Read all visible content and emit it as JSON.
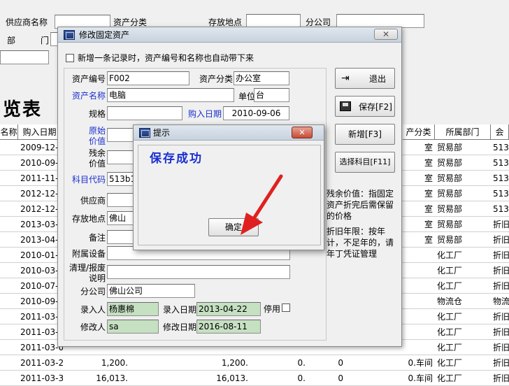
{
  "top_form": {
    "supplier_label": "供应商名称",
    "category_label": "资产分类",
    "location_label": "存放地点",
    "branch_label": "分公司",
    "dept_label": "部",
    "dept_label2": "门"
  },
  "list_title": "览表",
  "list_headers": [
    "名称",
    "购入日期",
    "产分类",
    "所属部门",
    "会"
  ],
  "list_rows": [
    {
      "date": "2009-12-3",
      "cat": "室",
      "dept": "贸易部",
      "acct": "513"
    },
    {
      "date": "2010-09-0",
      "cat": "室",
      "dept": "贸易部",
      "acct": "513"
    },
    {
      "date": "2011-11-3",
      "cat": "室",
      "dept": "贸易部",
      "acct": "513"
    },
    {
      "date": "2012-12-3",
      "cat": "室",
      "dept": "贸易部",
      "acct": "513"
    },
    {
      "date": "2012-12-3",
      "cat": "室",
      "dept": "贸易部",
      "acct": "513"
    },
    {
      "date": "2013-03-",
      "cat": "室",
      "dept": "贸易部",
      "acct": "折旧"
    },
    {
      "date": "2013-04-2",
      "cat": "室",
      "dept": "贸易部",
      "acct": "折旧"
    },
    {
      "date": "2010-01-1",
      "cat": "",
      "dept": "化工厂",
      "acct": "折旧"
    },
    {
      "date": "2010-03-1",
      "cat": "",
      "dept": "化工厂",
      "acct": "折旧"
    },
    {
      "date": "2010-07-2",
      "cat": "",
      "dept": "化工厂",
      "acct": "折旧"
    },
    {
      "date": "2010-09-0",
      "cat": "",
      "dept": "物流仓",
      "acct": "物流"
    },
    {
      "date": "2011-03-0",
      "cat": "",
      "dept": "化工厂",
      "acct": "折旧"
    },
    {
      "date": "2011-03-0",
      "cat": "",
      "dept": "化工厂",
      "acct": "折旧"
    },
    {
      "date": "2011-03-0",
      "cat": "",
      "dept": "化工厂",
      "acct": "折旧"
    },
    {
      "date": "2011-03-24",
      "v1": "1,200.",
      "v2": "1,200.",
      "v3": "0.",
      "v4": "0",
      "cat": "0.车间",
      "dept": "化工厂",
      "acct": "折旧"
    },
    {
      "date": "2011-03-31",
      "v1": "16,013.",
      "v2": "16,013.",
      "v3": "0.",
      "v4": "0",
      "cat": "0.车间",
      "dept": "化工厂",
      "acct": "折旧"
    }
  ],
  "dialog": {
    "title": "修改固定资产",
    "auto_carry_label": "新增一条记录时，资产编号和名称也自动带下来",
    "asset_no_label": "资产编号",
    "asset_no": "F002",
    "category_label": "资产分类",
    "category": "办公室",
    "asset_name_label": "资产名称",
    "asset_name": "电脑",
    "unit_label": "单位",
    "unit": "台",
    "spec_label": "规格",
    "purchase_date_label": "购入日期",
    "purchase_date": "2010-09-06",
    "orig_value_label1": "原始",
    "orig_value_label2": "价值",
    "residual_label1": "残余",
    "residual_label2": "价值",
    "subject_code_label": "科目代码",
    "subject_code": "513b1",
    "supplier_label": "供应商",
    "location_label": "存放地点",
    "location": "佛山",
    "remark_label": "备注",
    "attached_label": "附属设备",
    "disposal_label1": "清理/报废",
    "disposal_label2": "说明",
    "branch_label": "分公司",
    "branch": "佛山公司",
    "entered_by_label": "录入人",
    "entered_by": "杨惠棉",
    "entry_date_label": "录入日期",
    "entry_date": "2013-04-22",
    "disabled_label": "停用",
    "modified_by_label": "修改人",
    "modified_by": "sa",
    "modify_date_label": "修改日期",
    "modify_date": "2016-08-11",
    "exit_label": "退出",
    "save_label": "保存[F2]",
    "new_label": "新增[F3]",
    "select_subject_label": "选择科目[F11]",
    "note1": "残余价值：指固定资产折完后需保留的价格",
    "note2": "折旧年限：按年计，不足年的，请年丁凭证管理"
  },
  "toast": {
    "title": "提示",
    "message": "保存成功",
    "ok_label": "确定"
  },
  "colors": {
    "blue_label": "#1a2fd0",
    "readonly_green": "#c6e0c2",
    "arrow_red": "#e02020"
  }
}
